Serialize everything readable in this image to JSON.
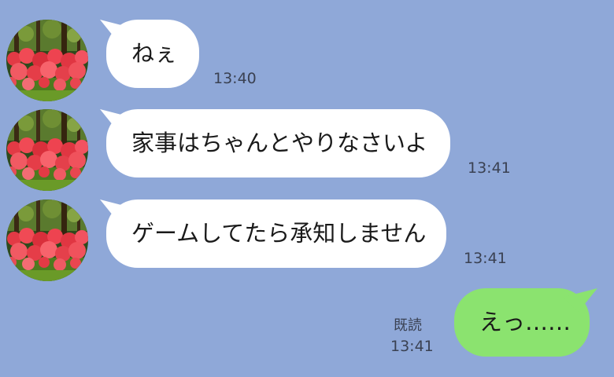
{
  "colors": {
    "background": "#8fa8d8",
    "incoming_bubble": "#ffffff",
    "outgoing_bubble": "#8be36f",
    "meta_text": "#3a4152"
  },
  "avatar": {
    "icon": "red-spider-lily-photo"
  },
  "messages": [
    {
      "direction": "incoming",
      "text": "ねぇ",
      "time": "13:40"
    },
    {
      "direction": "incoming",
      "text": "家事はちゃんとやりなさいよ",
      "time": "13:41"
    },
    {
      "direction": "incoming",
      "text": "ゲームしてたら承知しません",
      "time": "13:41"
    },
    {
      "direction": "outgoing",
      "text": "えっ……",
      "time": "13:41",
      "read_label": "既読"
    }
  ]
}
